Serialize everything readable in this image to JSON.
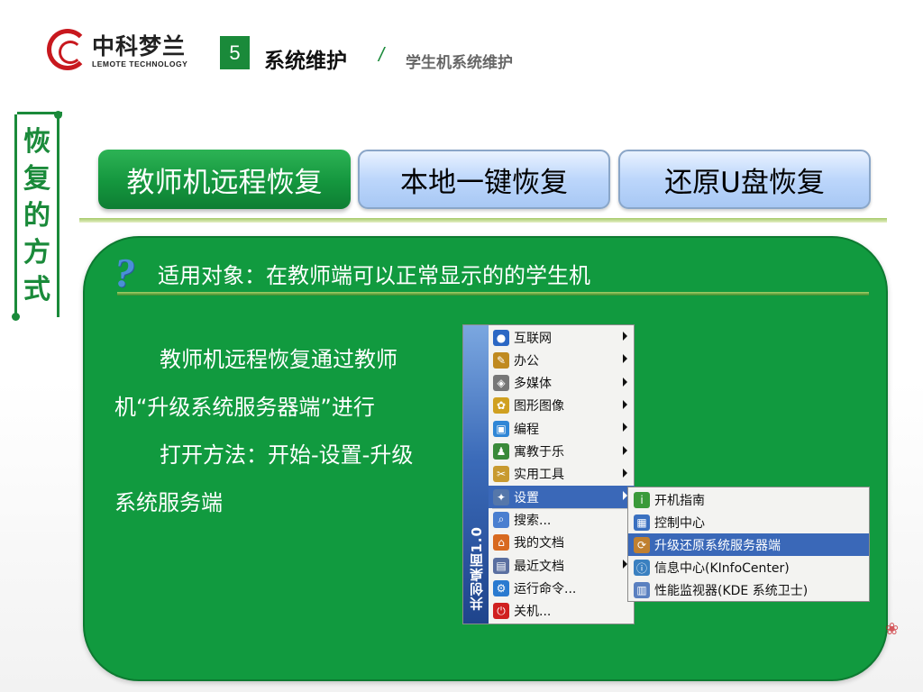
{
  "header": {
    "logo_cn": "中科梦兰",
    "logo_en": "LEMOTE TECHNOLOGY",
    "chapter_number": "5",
    "chapter_title": "系统维护",
    "separator": "/",
    "subtitle": "学生机系统维护"
  },
  "side_label": "恢复的方式",
  "tabs": [
    {
      "label": "教师机远程恢复",
      "active": true
    },
    {
      "label": "本地一键恢复",
      "active": false
    },
    {
      "label": "还原U盘恢复",
      "active": false
    }
  ],
  "panel": {
    "subject_icon": "question-mark-icon",
    "subject": "适用对象：在教师端可以正常显示的的学生机",
    "paragraph1": "教师机远程恢复通过教师机“升级系统服务器端”进行",
    "paragraph2": "打开方法：开始-设置-升级系统服务端"
  },
  "start_menu": {
    "strip_label": "共创桌面1.0",
    "items": [
      {
        "label": "互联网",
        "icon": "globe-icon",
        "submenu": true
      },
      {
        "label": "办公",
        "icon": "office-icon",
        "submenu": true
      },
      {
        "label": "多媒体",
        "icon": "multimedia-icon",
        "submenu": true
      },
      {
        "label": "图形图像",
        "icon": "graphics-icon",
        "submenu": true
      },
      {
        "label": "编程",
        "icon": "programming-icon",
        "submenu": true
      },
      {
        "label": "寓教于乐",
        "icon": "education-icon",
        "submenu": true
      },
      {
        "label": "实用工具",
        "icon": "tools-icon",
        "submenu": true
      },
      {
        "label": "设置",
        "icon": "wrench-icon",
        "submenu": true,
        "highlighted": true
      },
      {
        "label": "搜索...",
        "icon": "search-icon",
        "submenu": false
      },
      {
        "label": "我的文档",
        "icon": "home-icon",
        "submenu": false
      },
      {
        "label": "最近文档",
        "icon": "documents-icon",
        "submenu": true
      },
      {
        "label": "运行命令...",
        "icon": "run-icon",
        "submenu": false
      },
      {
        "label": "关机...",
        "icon": "power-icon",
        "submenu": false
      }
    ]
  },
  "settings_submenu": {
    "items": [
      {
        "label": "开机指南",
        "icon": "guide-icon"
      },
      {
        "label": "控制中心",
        "icon": "control-center-icon"
      },
      {
        "label": "升级还原系统服务器端",
        "icon": "upgrade-server-icon",
        "highlighted": true
      },
      {
        "label": "信息中心(KInfoCenter)",
        "icon": "info-center-icon"
      },
      {
        "label": "性能监视器(KDE 系统卫士)",
        "icon": "performance-monitor-icon"
      }
    ]
  },
  "colors": {
    "primary_green": "#119a3f",
    "tab_blue": "#bcd6fb",
    "menu_highlight": "#3a68b8",
    "brand_red": "#c8181e"
  }
}
